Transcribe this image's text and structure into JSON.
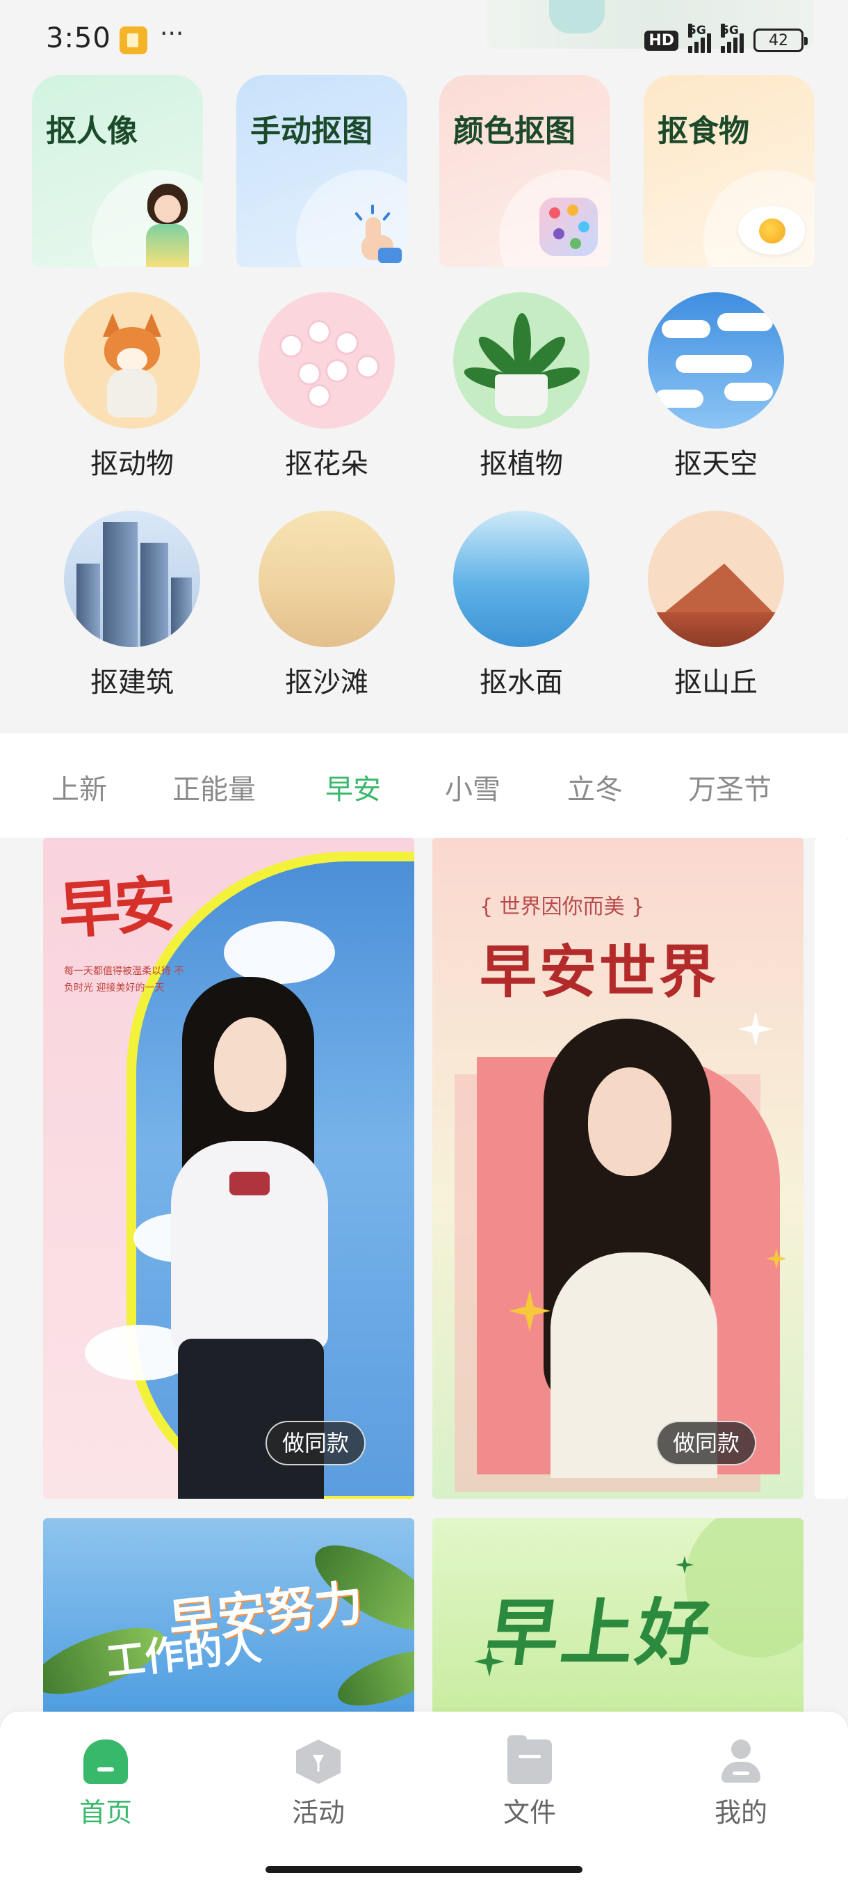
{
  "status_bar": {
    "time": "3:50",
    "more": "···",
    "hd": "HD",
    "net_1": "5G",
    "net_2": "5G",
    "battery": "42"
  },
  "features": [
    {
      "label": "抠人像",
      "icon": "portrait-icon"
    },
    {
      "label": "手动抠图",
      "icon": "hand-tap-icon"
    },
    {
      "label": "颜色抠图",
      "icon": "palette-icon"
    },
    {
      "label": "抠食物",
      "icon": "fried-egg-icon"
    }
  ],
  "categories": [
    {
      "label": "抠动物",
      "icon": "fox-icon"
    },
    {
      "label": "抠花朵",
      "icon": "flower-icon"
    },
    {
      "label": "抠植物",
      "icon": "potted-plant-icon"
    },
    {
      "label": "抠天空",
      "icon": "sky-icon"
    },
    {
      "label": "抠建筑",
      "icon": "building-icon"
    },
    {
      "label": "抠沙滩",
      "icon": "beach-icon"
    },
    {
      "label": "抠水面",
      "icon": "water-icon"
    },
    {
      "label": "抠山丘",
      "icon": "hill-icon"
    }
  ],
  "tabs": [
    {
      "label": "上新",
      "active": false
    },
    {
      "label": "正能量",
      "active": false
    },
    {
      "label": "早安",
      "active": true
    },
    {
      "label": "小雪",
      "active": false
    },
    {
      "label": "立冬",
      "active": false
    },
    {
      "label": "万圣节",
      "active": false
    }
  ],
  "templates": [
    {
      "title": "早安",
      "small_text": "每一天都值得被温柔以待 不负时光 迎接美好的一天",
      "button": "做同款"
    },
    {
      "subtitle": "{ 世界因你而美 }",
      "title": "早安世界",
      "button": "做同款"
    },
    {
      "title": "早安努力",
      "title2": "工作的人"
    },
    {
      "title": "早上好"
    }
  ],
  "bottom_nav": [
    {
      "label": "首页",
      "icon": "home-icon",
      "active": true
    },
    {
      "label": "活动",
      "icon": "activity-icon",
      "active": false
    },
    {
      "label": "文件",
      "icon": "folder-icon",
      "active": false
    },
    {
      "label": "我的",
      "icon": "profile-icon",
      "active": false
    }
  ],
  "colors": {
    "accent": "#38b86a",
    "inactive_tab": "#8a8a8a",
    "feature_title": "#1b4a2b"
  }
}
